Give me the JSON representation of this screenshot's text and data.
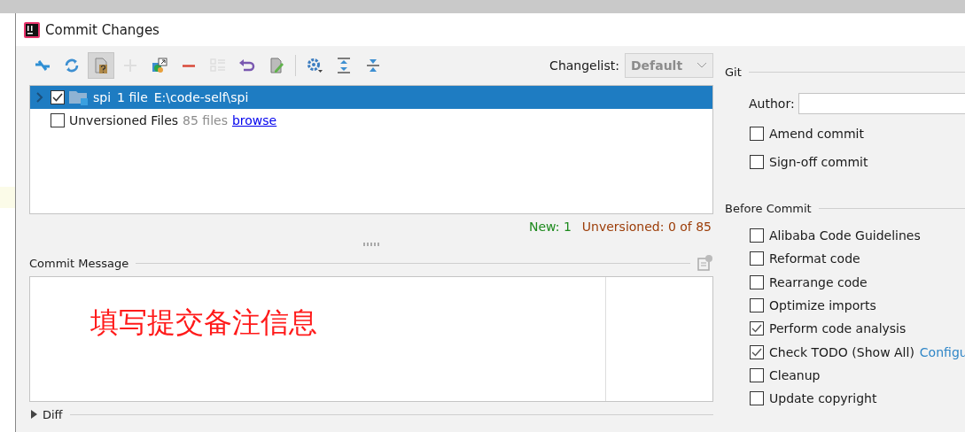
{
  "window": {
    "title": "Commit Changes"
  },
  "toolbar": [
    {
      "kind": "arrows",
      "disabled": false,
      "selected": false
    },
    {
      "kind": "refresh",
      "disabled": false,
      "selected": false
    },
    {
      "kind": "unversioned",
      "disabled": false,
      "selected": true
    },
    {
      "kind": "add",
      "disabled": true,
      "selected": false
    },
    {
      "kind": "diff",
      "disabled": false,
      "selected": false
    },
    {
      "kind": "remove",
      "disabled": false,
      "selected": false
    },
    {
      "kind": "group",
      "disabled": true,
      "selected": false
    },
    {
      "kind": "revert",
      "disabled": false,
      "selected": false
    },
    {
      "kind": "edit",
      "disabled": false,
      "selected": false
    },
    {
      "kind": "separator"
    },
    {
      "kind": "settings",
      "disabled": false,
      "selected": false
    },
    {
      "kind": "expand",
      "disabled": false,
      "selected": false
    },
    {
      "kind": "collapse",
      "disabled": false,
      "selected": false
    }
  ],
  "changelist": {
    "label": "Changelist:",
    "value": "Default"
  },
  "tree": [
    {
      "kind": "module",
      "name": "spi",
      "count": "1 file",
      "path": "E:\\code-self\\spi",
      "checked": true,
      "selected": true,
      "expanded": false
    },
    {
      "kind": "unversioned",
      "name": "Unversioned Files",
      "count": "85 files",
      "link": "browse",
      "checked": false,
      "selected": false
    }
  ],
  "summary": {
    "new": "New: 1",
    "unversioned": "Unversioned: 0 of 85"
  },
  "commit_message": {
    "label": "Commit Message",
    "value": "填写提交备注信息"
  },
  "diff": {
    "label": "Diff",
    "expanded": false
  },
  "git": {
    "title": "Git",
    "author_label": "Author:",
    "options": [
      {
        "label": "Amend commit",
        "checked": false
      },
      {
        "label": "Sign-off commit",
        "checked": false
      }
    ]
  },
  "before_commit": {
    "title": "Before Commit",
    "options": [
      {
        "label": "Alibaba Code Guidelines",
        "checked": false
      },
      {
        "label": "Reformat code",
        "checked": false
      },
      {
        "label": "Rearrange code",
        "checked": false
      },
      {
        "label": "Optimize imports",
        "checked": false
      },
      {
        "label": "Perform code analysis",
        "checked": true
      },
      {
        "label": "Check TODO (Show All)",
        "checked": true,
        "link": "Configu"
      },
      {
        "label": "Cleanup",
        "checked": false
      },
      {
        "label": "Update copyright",
        "checked": false
      }
    ]
  }
}
